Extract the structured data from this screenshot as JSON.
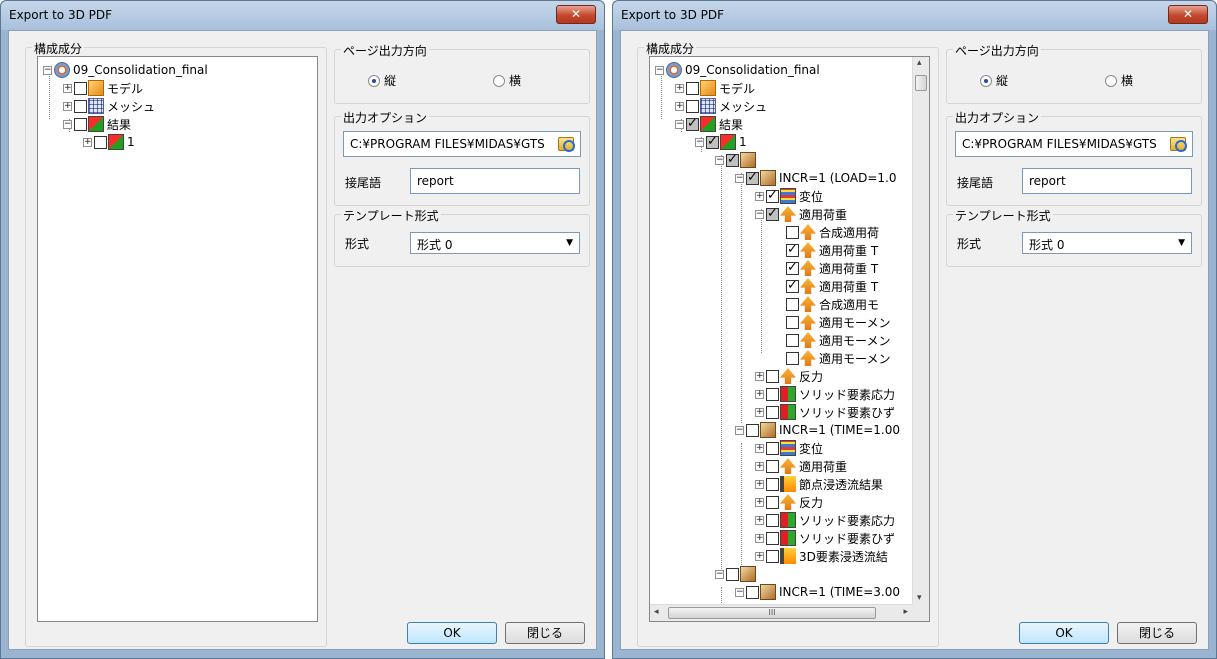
{
  "dialog": {
    "title": "Export to 3D PDF",
    "close_label": "✕",
    "components_label": "構成成分",
    "page_direction_label": "ページ出力方向",
    "portrait_label": "縦",
    "landscape_label": "横",
    "output_options_label": "出力オプション",
    "output_path": "C:¥PROGRAM FILES¥MIDAS¥GTS",
    "suffix_label": "接尾語",
    "suffix_value": "report",
    "template_label": "テンプレート形式",
    "format_label": "形式",
    "format_value": "形式 0",
    "ok_label": "OK",
    "cancel_label": "閉じる"
  },
  "left_tree": [
    {
      "label": "09_Consolidation_final",
      "icon": "compass-icon"
    },
    {
      "label": "モデル",
      "icon": "model-icon"
    },
    {
      "label": "メッシュ",
      "icon": "mesh-icon"
    },
    {
      "label": "結果",
      "icon": "result-icon"
    },
    {
      "label": "1",
      "icon": "result-icon"
    }
  ],
  "right_tree": [
    {
      "label": "09_Consolidation_final",
      "icon": "compass-icon"
    },
    {
      "label": "モデル",
      "icon": "model-icon"
    },
    {
      "label": "メッシュ",
      "icon": "mesh-icon"
    },
    {
      "label": "結果",
      "icon": "result-icon"
    },
    {
      "label": "1",
      "icon": "result-icon"
    },
    {
      "label": "",
      "icon": "stage-icon"
    },
    {
      "label": "INCR=1 (LOAD=1.0",
      "icon": "stage-icon"
    },
    {
      "label": "変位",
      "icon": "displacement-icon"
    },
    {
      "label": "適用荷重",
      "icon": "load-icon"
    },
    {
      "label": "合成適用荷",
      "icon": "load-icon"
    },
    {
      "label": "適用荷重 T",
      "icon": "load-icon"
    },
    {
      "label": "適用荷重 T",
      "icon": "load-icon"
    },
    {
      "label": "適用荷重 T",
      "icon": "load-icon"
    },
    {
      "label": "合成適用モ",
      "icon": "load-icon"
    },
    {
      "label": "適用モーメン",
      "icon": "load-icon"
    },
    {
      "label": "適用モーメン",
      "icon": "load-icon"
    },
    {
      "label": "適用モーメン",
      "icon": "load-icon"
    },
    {
      "label": "反力",
      "icon": "load-icon"
    },
    {
      "label": "ソリッド要素応力",
      "icon": "stress-icon"
    },
    {
      "label": "ソリッド要素ひず",
      "icon": "stress-icon"
    },
    {
      "label": "INCR=1 (TIME=1.00",
      "icon": "stage-icon"
    },
    {
      "label": "変位",
      "icon": "displacement-icon"
    },
    {
      "label": "適用荷重",
      "icon": "load-icon"
    },
    {
      "label": "節点浸透流結果",
      "icon": "seepage-icon"
    },
    {
      "label": "反力",
      "icon": "load-icon"
    },
    {
      "label": "ソリッド要素応力",
      "icon": "stress-icon"
    },
    {
      "label": "ソリッド要素ひず",
      "icon": "stress-icon"
    },
    {
      "label": "3D要素浸透流結",
      "icon": "seepage-icon"
    },
    {
      "label": "",
      "icon": "stage-icon"
    },
    {
      "label": "INCR=1 (TIME=3.00",
      "icon": "stage-icon"
    }
  ],
  "scroll": {
    "h_thumb_glyph": "III",
    "left_arrow": "◂",
    "right_arrow": "▸",
    "up_arrow": "▴",
    "down_arrow": "▾"
  }
}
